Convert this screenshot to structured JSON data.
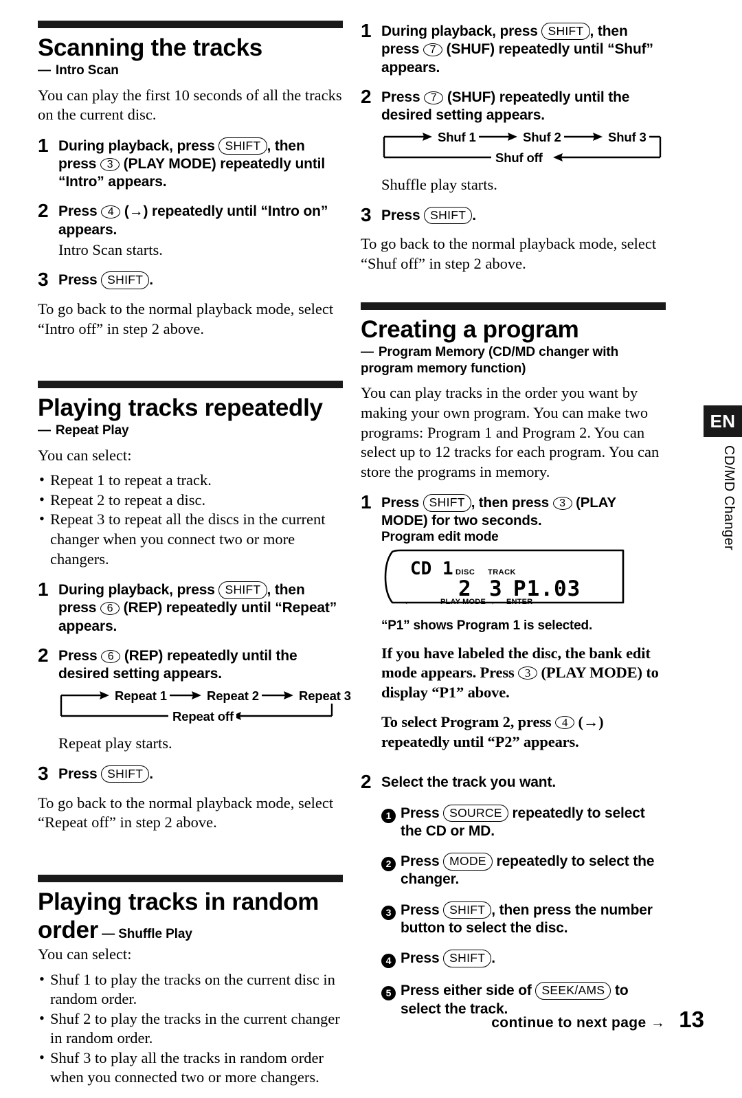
{
  "locale_tab": "EN",
  "running_head": "CD/MD Changer",
  "footer": {
    "continue_text": "continue to next page",
    "arrow": "→",
    "page_number": "13"
  },
  "left_column": {
    "sections": [
      {
        "title": "Scanning the tracks",
        "subtitle_dash": "—",
        "subtitle": "Intro Scan",
        "intro": "You can play the first 10 seconds of all the tracks on the current disc.",
        "steps": [
          {
            "num": "1",
            "text_a": "During playback, press ",
            "key_1": "SHIFT",
            "text_b": ", then press ",
            "key_2": "3",
            "text_c": " (PLAY MODE) repeatedly until “Intro” appears."
          },
          {
            "num": "2",
            "text_a": "Press ",
            "key_1": "4",
            "text_b": " (→) repeatedly until “Intro on” appears.",
            "note": "Intro Scan starts."
          },
          {
            "num": "3",
            "text_a": "Press ",
            "key_1": "SHIFT",
            "text_b": "."
          }
        ],
        "outro": "To go back to the normal playback mode, select “Intro off” in step 2 above."
      },
      {
        "title": "Playing tracks repeatedly",
        "subtitle_dash": "—",
        "subtitle": "Repeat Play",
        "intro": "You can select:",
        "bullets": [
          "Repeat 1 to repeat a track.",
          "Repeat 2 to repeat a disc.",
          "Repeat 3 to repeat all the discs in the current changer when you connect two or more changers."
        ],
        "steps": [
          {
            "num": "1",
            "text_a": "During playback, press ",
            "key_1": "SHIFT",
            "text_b": ", then press ",
            "key_2": "6",
            "text_c": " (REP) repeatedly until “Repeat” appears."
          },
          {
            "num": "2",
            "text_a": "Press ",
            "key_1": "6",
            "text_b": " (REP) repeatedly until the desired setting appears.",
            "note": "Repeat play starts."
          },
          {
            "num": "3",
            "text_a": "Press ",
            "key_1": "SHIFT",
            "text_b": "."
          }
        ],
        "cycle": {
          "items": [
            "Repeat 1",
            "Repeat 2",
            "Repeat 3"
          ],
          "off_label": "Repeat off"
        },
        "outro": "To go back to the normal playback mode, select “Repeat off” in step 2 above."
      },
      {
        "title_line1": "Playing tracks in random",
        "title_line2": "order",
        "subtitle_dash": "—",
        "subtitle": "Shuffle Play",
        "intro": "You can select:",
        "bullets": [
          "Shuf 1 to play the tracks on the current disc in random order.",
          "Shuf 2 to play the tracks in the current changer in random order.",
          "Shuf 3 to play all the tracks in random order when you connected two or more changers."
        ]
      }
    ]
  },
  "right_column": {
    "shuffle_steps": [
      {
        "num": "1",
        "text_a": "During playback, press ",
        "key_1": "SHIFT",
        "text_b": ", then press ",
        "key_2": "7",
        "text_c": " (SHUF) repeatedly until “Shuf” appears."
      },
      {
        "num": "2",
        "text_a": "Press ",
        "key_1": "7",
        "text_b": " (SHUF) repeatedly until the desired setting appears.",
        "note": "Shuffle play starts."
      },
      {
        "num": "3",
        "text_a": "Press ",
        "key_1": "SHIFT",
        "text_b": "."
      }
    ],
    "shuffle_cycle": {
      "items": [
        "Shuf 1",
        "Shuf 2",
        "Shuf 3"
      ],
      "off_label": "Shuf off"
    },
    "shuffle_outro": "To go back to the normal playback mode, select “Shuf off” in step 2 above.",
    "program_section": {
      "title": "Creating a program",
      "subtitle_dash": "—",
      "subtitle": "Program Memory (CD/MD changer with program memory function)",
      "intro": "You can play tracks in the order you want by making your own program. You can make two programs: Program 1 and Program 2. You can select up to 12 tracks for each program. You can store the programs in memory.",
      "step1": {
        "num": "1",
        "text_a": "Press ",
        "key_1": "SHIFT",
        "text_b": ", then press ",
        "key_2": "3",
        "text_c": " (PLAY MODE) for two seconds."
      },
      "lcd": {
        "caption": "Program edit mode",
        "source_label": "CD 1",
        "disc_label": "DISC",
        "disc_value": "2",
        "track_label": "TRACK",
        "track_value": "3",
        "program_value": "P1.03",
        "left_arrow": "←",
        "play_mode_label": "PLAY MODE",
        "right_arrow": "→",
        "enter_label": "ENTER"
      },
      "lcd_note": "“P1” shows Program 1 is selected.",
      "para_bank_a": "If you have labeled the disc, the bank edit mode appears. Press ",
      "para_bank_key": "3",
      "para_bank_b": " (PLAY MODE) to display “P1” above.",
      "para_prog2_a": "To select Program 2, press ",
      "para_prog2_key": "4",
      "para_prog2_b": " (→) repeatedly until “P2” appears.",
      "step2": {
        "num": "2",
        "text": "Select the track you want."
      },
      "substeps": [
        {
          "marker": "1",
          "text_a": "Press ",
          "key_1": "SOURCE",
          "text_b": " repeatedly to select the CD or MD."
        },
        {
          "marker": "2",
          "text_a": "Press ",
          "key_1": "MODE",
          "text_b": " repeatedly to select the changer."
        },
        {
          "marker": "3",
          "text_a": "Press ",
          "key_1": "SHIFT",
          "text_b": ", then press the number button to select the disc."
        },
        {
          "marker": "4",
          "text_a": "Press ",
          "key_1": "SHIFT",
          "text_b": "."
        },
        {
          "marker": "5",
          "text_a": "Press either side of ",
          "key_1": "SEEK/AMS",
          "text_b": " to select the track."
        }
      ]
    }
  }
}
